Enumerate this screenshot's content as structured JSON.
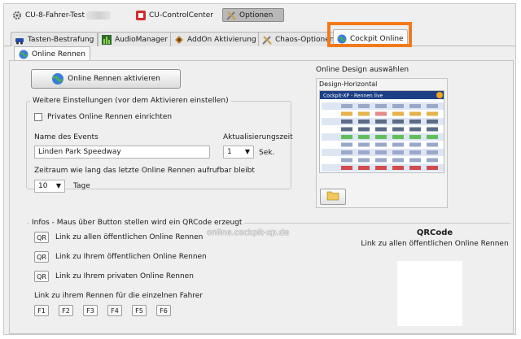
{
  "top_tabs": [
    {
      "label": "CU-8-Fahrer-Test"
    },
    {
      "label": "CU-ControlCenter"
    },
    {
      "label": "Optionen"
    }
  ],
  "sub_tabs": [
    {
      "label": "Tasten-Bestrafung"
    },
    {
      "label": "AudioManager"
    },
    {
      "label": "AddOn Aktivierung"
    },
    {
      "label": "Chaos-Optionen"
    },
    {
      "label": "Cockpit Online"
    }
  ],
  "inner_tab": {
    "label": "Online Rennen"
  },
  "activate_button": {
    "label": "Online Rennen aktivieren"
  },
  "further_settings": {
    "legend": "Weitere Einstellungen (vor dem Aktivieren einstellen)",
    "private_checkbox_label": "Privates Online Rennen einrichten",
    "private_checked": false,
    "event_name_label": "Name des Events",
    "event_name_value": "Linden Park Speedway",
    "update_time_label": "Aktualisierungszeit",
    "update_time_value": "1",
    "update_time_unit": "Sek.",
    "period_label": "Zeitraum wie lang das letzte Online Rennen aufrufbar bleibt",
    "period_value": "10",
    "period_unit": "Tage"
  },
  "design": {
    "heading": "Online Design auswählen",
    "selected": "Design-Horizontal",
    "preview_title": "Cockpit-XP - Rennen live"
  },
  "infos": {
    "legend": "Infos - Maus über Button stellen wird ein QRCode erzeugt",
    "qr_button_label": "QR",
    "links": [
      "Link zu allen öffentlichen Online Rennen",
      "Link zu Ihrem öffentlichen Online Rennen",
      "Link zu Ihrem privaten Online Rennen"
    ],
    "watermark": "online.cockpit-xp.de",
    "driver_links_label": "Link zu ihrem Rennen für die einzelnen Fahrer",
    "driver_buttons": [
      "F1",
      "F2",
      "F3",
      "F4",
      "F5",
      "F6"
    ]
  },
  "qrcode": {
    "title": "QRCode",
    "caption": "Link zu allen öffentlichen Online Rennen"
  },
  "colors": {
    "highlight": "#f27a1a",
    "preview_header": "#1d3f86"
  }
}
